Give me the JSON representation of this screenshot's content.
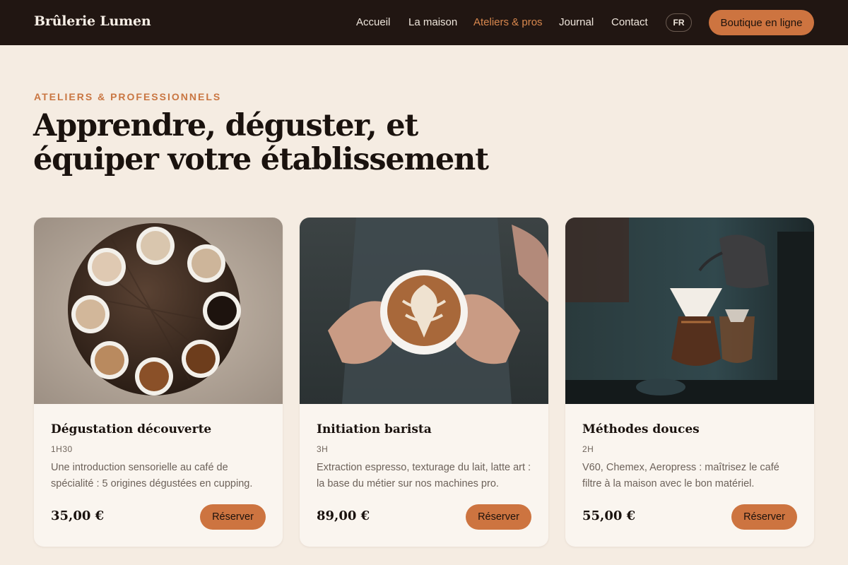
{
  "header": {
    "brand": "Brûlerie Lumen",
    "nav": [
      {
        "label": "Accueil",
        "active": false
      },
      {
        "label": "La maison",
        "active": false
      },
      {
        "label": "Ateliers & pros",
        "active": true
      },
      {
        "label": "Journal",
        "active": false
      },
      {
        "label": "Contact",
        "active": false
      }
    ],
    "language": "FR",
    "shop_button": "Boutique en ligne"
  },
  "hero": {
    "eyebrow": "ATELIERS & PROFESSIONNELS",
    "title_line1": "Apprendre, déguster, et",
    "title_line2": "équiper votre établissement"
  },
  "cards": [
    {
      "title": "Dégustation découverte",
      "duration": "1H30",
      "description": "Une introduction sensorielle au café de spécialité : 5 origines dégustées en cupping.",
      "price": "35,00 €",
      "button": "Réserver",
      "image": "coffee-cups-tasting-photo"
    },
    {
      "title": "Initiation barista",
      "duration": "3H",
      "description": "Extraction espresso, texturage du lait, latte art : la base du métier sur nos machines pro.",
      "price": "89,00 €",
      "button": "Réserver",
      "image": "latte-art-hands-photo"
    },
    {
      "title": "Méthodes douces",
      "duration": "2H",
      "description": "V60, Chemex, Aeropress : maîtrisez le café filtre à la maison avec le bon matériel.",
      "price": "55,00 €",
      "button": "Réserver",
      "image": "pour-over-brewing-photo"
    }
  ],
  "colors": {
    "header_bg": "#211612",
    "page_bg": "#f5ece2",
    "accent": "#cd7440",
    "card_bg": "#faf5ef"
  }
}
